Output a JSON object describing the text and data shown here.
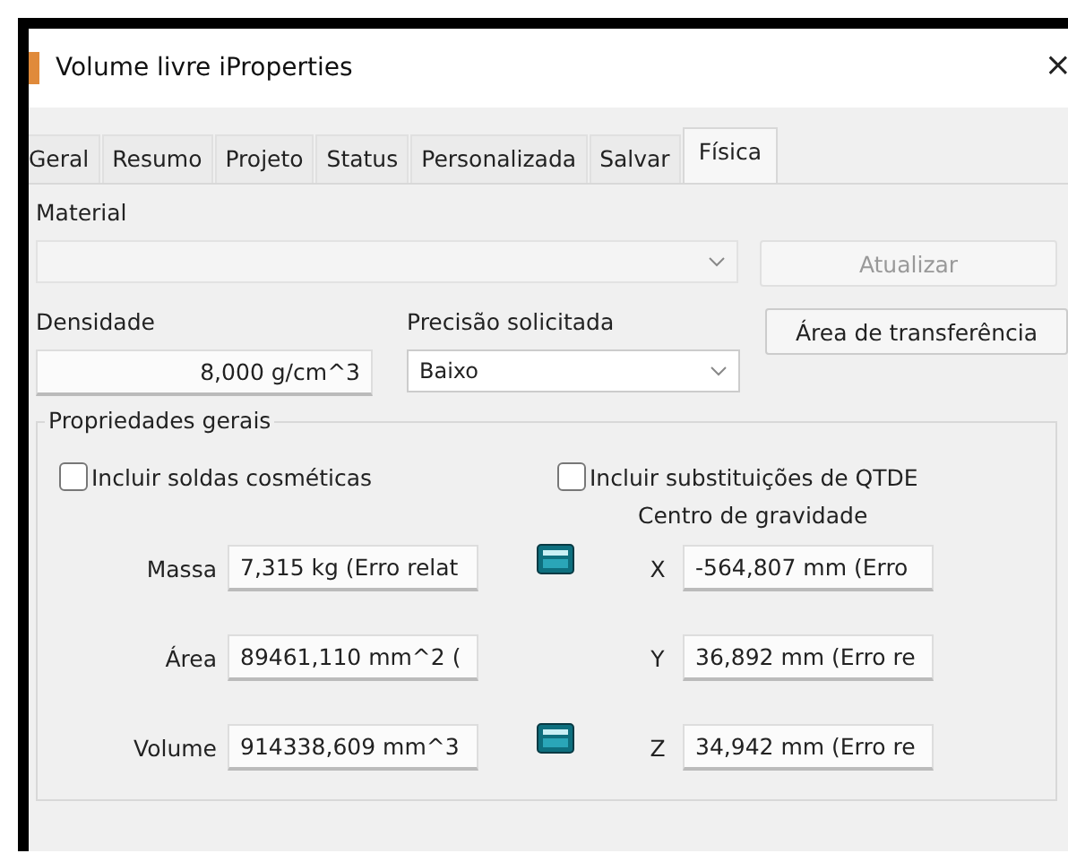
{
  "window": {
    "title": "Volume livre iProperties",
    "close": "×"
  },
  "tabs": [
    {
      "label": "Geral",
      "selected": false
    },
    {
      "label": "Resumo",
      "selected": false
    },
    {
      "label": "Projeto",
      "selected": false
    },
    {
      "label": "Status",
      "selected": false
    },
    {
      "label": "Personalizada",
      "selected": false
    },
    {
      "label": "Salvar",
      "selected": false
    },
    {
      "label": "Física",
      "selected": true
    }
  ],
  "material": {
    "label": "Material",
    "disabled": true
  },
  "update_button": {
    "label": "Atualizar",
    "disabled": true
  },
  "density": {
    "label": "Densidade",
    "value": "8,000 g/cm^3"
  },
  "precision": {
    "label": "Precisão solicitada",
    "value": "Baixo"
  },
  "clipboard_button": {
    "label": "Área de transferência"
  },
  "general": {
    "title": "Propriedades gerais",
    "checkboxes": [
      {
        "label": "Incluir soldas cosméticas",
        "checked": false
      },
      {
        "label": "Incluir substituições de QTDE",
        "checked": false
      }
    ],
    "center_title": "Centro de gravidade",
    "rows": [
      {
        "label": "Massa",
        "value": "7,315 kg (Erro relat",
        "calculator": true,
        "axis": "X",
        "axis_value": "-564,807 mm (Erro"
      },
      {
        "label": "Área",
        "value": "89461,110 mm^2 (",
        "calculator": false,
        "axis": "Y",
        "axis_value": "36,892 mm (Erro re"
      },
      {
        "label": "Volume",
        "value": "914338,609 mm^3",
        "calculator": true,
        "axis": "Z",
        "axis_value": "34,942 mm (Erro re"
      }
    ]
  }
}
